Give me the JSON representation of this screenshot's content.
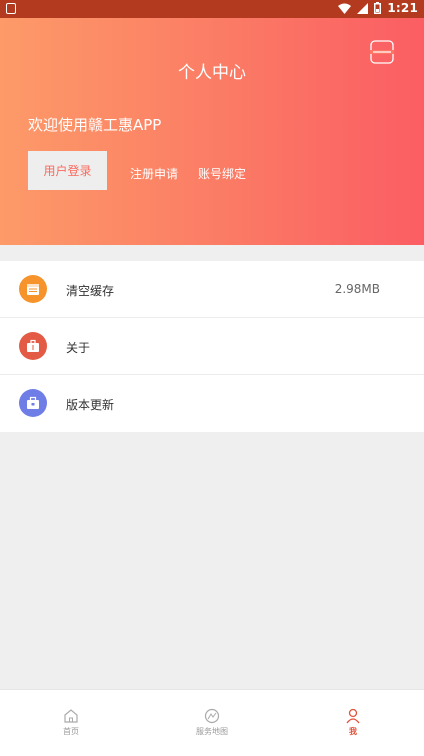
{
  "status_bar": {
    "time": "1:21"
  },
  "header": {
    "title": "个人中心",
    "welcome": "欢迎使用赣工惠APP",
    "login_label": "用户登录",
    "register_label": "注册申请",
    "bind_label": "账号绑定"
  },
  "menu": [
    {
      "label": "清空缓存",
      "value": "2.98MB",
      "icon": "cache-icon",
      "color": "#f6932a"
    },
    {
      "label": "关于",
      "icon": "briefcase-icon",
      "color": "#e45b45"
    },
    {
      "label": "版本更新",
      "icon": "toolbox-icon",
      "color": "#6f7ee6"
    }
  ],
  "tabs": [
    {
      "label": "首页",
      "icon": "home-icon"
    },
    {
      "label": "服务地图",
      "icon": "map-icon"
    },
    {
      "label": "我",
      "icon": "person-icon"
    }
  ],
  "colors": {
    "accent": "#e0543c",
    "header_start": "#fd9a68",
    "header_end": "#fb5d63"
  }
}
